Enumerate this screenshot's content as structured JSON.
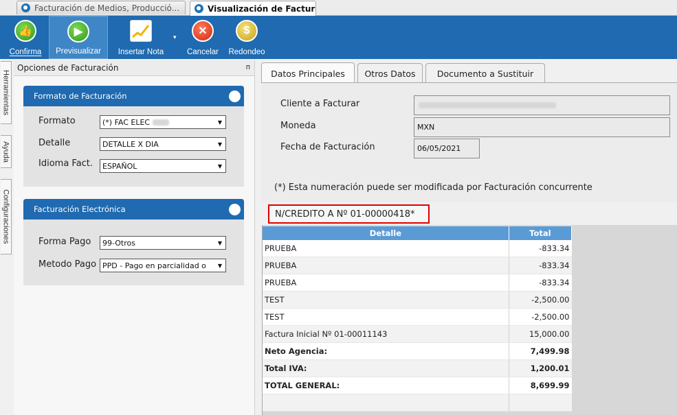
{
  "doc_tabs": [
    "Facturación de Medios, Producció...",
    "Visualización de Factura"
  ],
  "toolbar": [
    {
      "label": "Confirma",
      "icon": "thumbs-up-icon"
    },
    {
      "label": "Previsualizar",
      "icon": "play-icon"
    },
    {
      "label": "Insertar Nota",
      "icon": "chart-icon"
    },
    {
      "label": "Cancelar",
      "icon": "cancel-icon"
    },
    {
      "label": "Redondeo",
      "icon": "coins-icon"
    }
  ],
  "side_tabs": [
    "Herramientas",
    "Ayuda",
    "Configuraciones"
  ],
  "left_panel": {
    "title": "Opciones de Facturación",
    "pin": "ᴨ",
    "formato_group": {
      "title": "Formato de Facturación",
      "rows": [
        {
          "label": "Formato",
          "value": "(*) FAC ELEC"
        },
        {
          "label": "Detalle",
          "value": "DETALLE X DIA"
        },
        {
          "label": "Idioma Fact.",
          "value": "ESPAÑOL"
        }
      ]
    },
    "electronica_group": {
      "title": "Facturación Electrónica",
      "rows": [
        {
          "label": "Forma Pago",
          "value": "99-Otros"
        },
        {
          "label": "Metodo Pago",
          "value": "PPD - Pago en parcialidad o"
        }
      ]
    }
  },
  "right_tabs": [
    "Datos Principales",
    "Otros Datos",
    "Documento a Sustituir"
  ],
  "datos_principales": {
    "cliente_label": "Cliente a Facturar",
    "cliente_value": "",
    "moneda_label": "Moneda",
    "moneda_value": "MXN",
    "fecha_label": "Fecha de Facturación",
    "fecha_value": "06/05/2021",
    "note": "(*) Esta numeración puede ser modificada por Facturación concurrente"
  },
  "credit_tab": "N/CREDITO A Nº 01-00000418*",
  "grid": {
    "headers": [
      "Detalle",
      "Total"
    ],
    "rows": [
      {
        "detalle": "PRUEBA",
        "total": "-833.34",
        "bold": false
      },
      {
        "detalle": "PRUEBA",
        "total": "-833.34",
        "bold": false
      },
      {
        "detalle": "PRUEBA",
        "total": "-833.34",
        "bold": false
      },
      {
        "detalle": "TEST",
        "total": "-2,500.00",
        "bold": false
      },
      {
        "detalle": "TEST",
        "total": "-2,500.00",
        "bold": false
      },
      {
        "detalle": "Factura Inicial Nº 01-00011143",
        "total": "15,000.00",
        "bold": false
      },
      {
        "detalle": "Neto Agencia:",
        "total": "7,499.98",
        "bold": true
      },
      {
        "detalle": "Total IVA:",
        "total": "1,200.01",
        "bold": true
      },
      {
        "detalle": "TOTAL GENERAL:",
        "total": "8,699.99",
        "bold": true
      },
      {
        "detalle": "",
        "total": "",
        "bold": false
      }
    ]
  },
  "colors": {
    "ribbon": "#1f6ab0",
    "header_blue": "#5b9bd5",
    "highlight_red": "#e00000"
  }
}
